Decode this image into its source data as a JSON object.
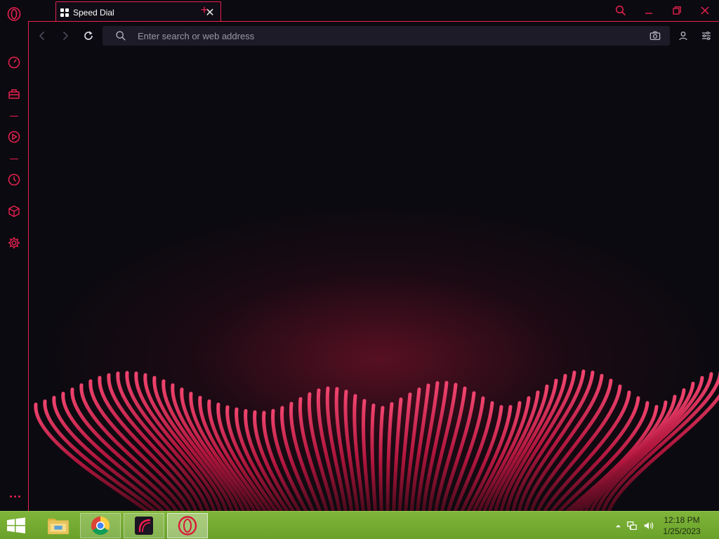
{
  "browser": {
    "tab": {
      "title": "Speed Dial",
      "close_symbol": "✕"
    },
    "add_tab_symbol": "+",
    "address_bar": {
      "placeholder": "Enter search or web address",
      "value": ""
    },
    "accent_color": "#e8214f",
    "sidebar_icons": [
      "opera-logo-icon",
      "speedometer-icon",
      "briefcase-icon",
      "video-player-icon",
      "history-clock-icon",
      "cube-extensions-icon",
      "gear-settings-icon",
      "more-dots-icon"
    ],
    "window_controls": [
      "search-tabs-icon",
      "minimize-icon",
      "restore-icon",
      "close-icon"
    ]
  },
  "taskbar": {
    "apps": [
      "file-explorer-icon",
      "chrome-icon",
      "opera-gx-icon",
      "opera-icon"
    ],
    "clock": {
      "time": "12:18 PM",
      "date": "1/25/2023"
    },
    "color": "#7fb539"
  }
}
